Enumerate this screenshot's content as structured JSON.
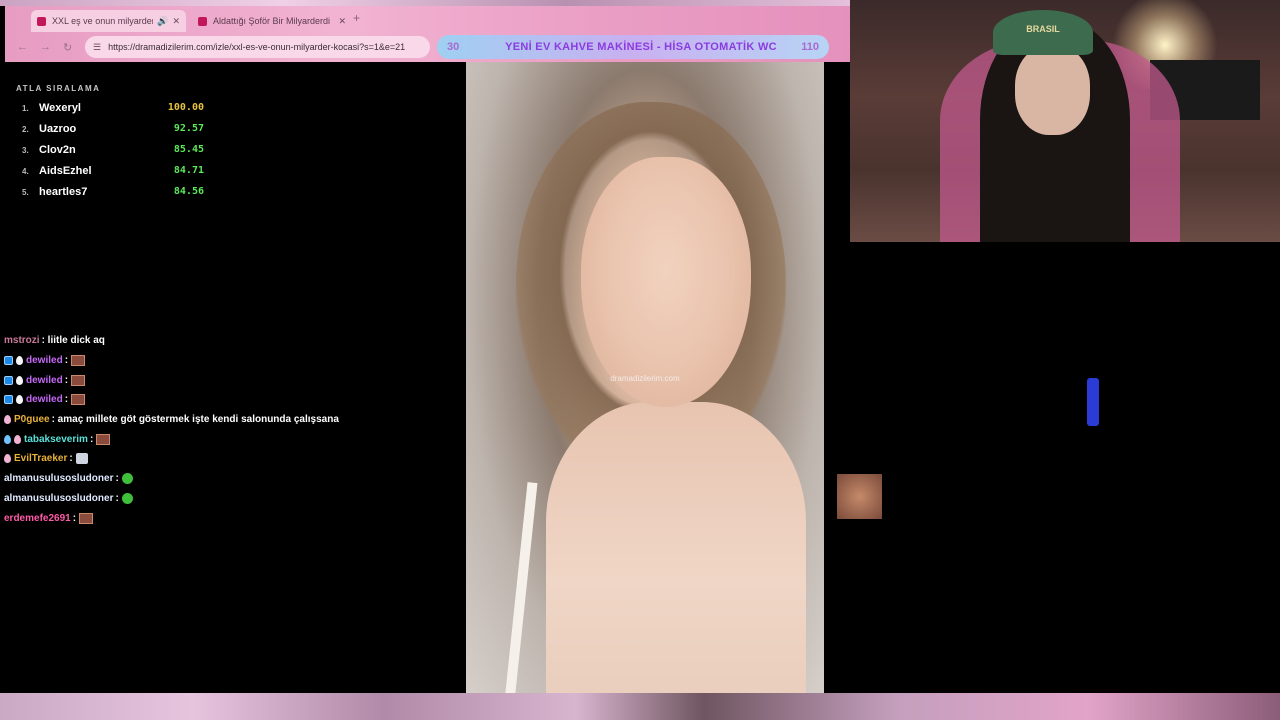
{
  "browser": {
    "tabs": [
      {
        "title": "XXL eş ve onun milyarder k",
        "active": true
      },
      {
        "title": "Aldattığı Şoför Bir Milyarderdi",
        "active": false
      }
    ],
    "url": "https://dramadizilerim.com/izle/xxl-es-ve-onun-milyarder-kocasi?s=1&e=21",
    "banner": {
      "left": "30",
      "text": "YENİ EV KAHVE MAKİNESİ - HİSA OTOMATİK WC",
      "right": "110"
    }
  },
  "leaderboard": {
    "title": "ATLA SIRALAMA",
    "rows": [
      {
        "rank": "1.",
        "name": "Wexeryl",
        "score": "100.00",
        "color": "#e8c341"
      },
      {
        "rank": "2.",
        "name": "Uazroo",
        "score": "92.57",
        "color": "#5ee85a"
      },
      {
        "rank": "3.",
        "name": "Clov2n",
        "score": "85.45",
        "color": "#5ee85a"
      },
      {
        "rank": "4.",
        "name": "AidsEzhel",
        "score": "84.71",
        "color": "#5ee85a"
      },
      {
        "rank": "5.",
        "name": "heartles7",
        "score": "84.56",
        "color": "#5ee85a"
      }
    ]
  },
  "chat": {
    "messages": [
      {
        "user": "mstrozi",
        "text": " : liitle dick aq",
        "color": "#c77a98"
      },
      {
        "user": "dewiled",
        "text": " :",
        "color": "#c468f5"
      },
      {
        "user": "dewiled",
        "text": " :",
        "color": "#c468f5"
      },
      {
        "user": "dewiled",
        "text": " :",
        "color": "#c468f5"
      },
      {
        "user": "P0guee",
        "text": " : amaç millete göt göstermek işte kendi salonunda çalışsana",
        "color": "#e8b13a"
      },
      {
        "user": "tabakseverim",
        "text": " :",
        "color": "#5ae0d8"
      },
      {
        "user": "EvilTraeker",
        "text": " :",
        "color": "#e8b13a"
      },
      {
        "user": "almanusulusosludoner",
        "text": " :",
        "color": "#dfe9ff"
      },
      {
        "user": "almanusulusosludoner",
        "text": " :",
        "color": "#dfe9ff"
      },
      {
        "user": "erdemefe2691",
        "text": " :",
        "color": "#ff5aa8"
      }
    ]
  },
  "video": {
    "watermark": "dramadizilerim.com"
  },
  "webcam": {
    "cap_text": "BRASIL"
  }
}
